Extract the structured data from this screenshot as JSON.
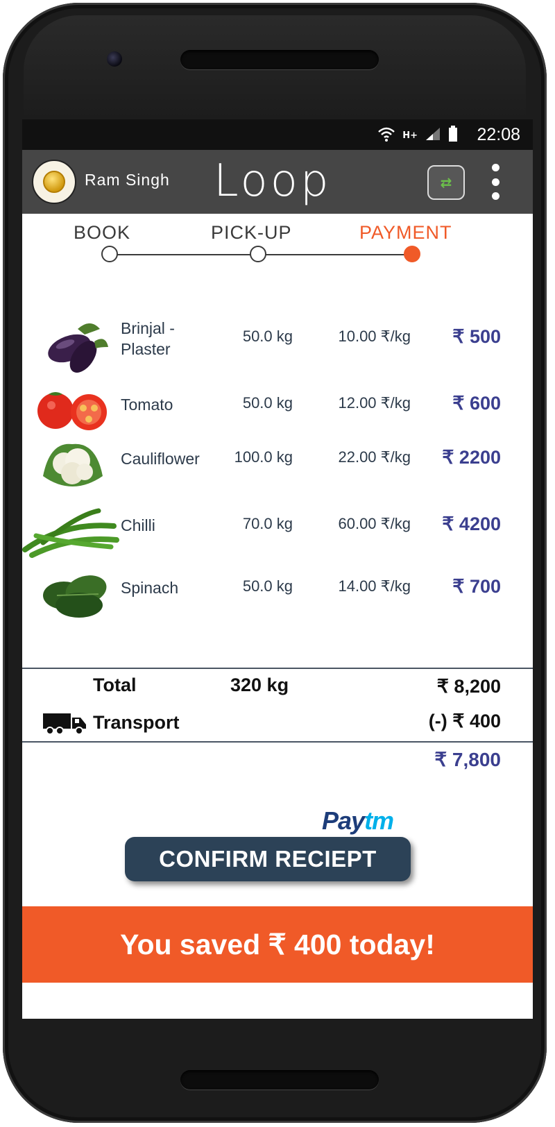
{
  "status_bar": {
    "network": "H+",
    "time": "22:08"
  },
  "app_bar": {
    "user_name": "Ram Singh",
    "logo": "Loop",
    "swap_icon": "swap-arrows-icon",
    "menu_icon": "overflow-menu-icon"
  },
  "stepper": {
    "steps": [
      {
        "label": "BOOK",
        "state": "done"
      },
      {
        "label": "PICK-UP",
        "state": "done"
      },
      {
        "label": "PAYMENT",
        "state": "active"
      }
    ],
    "active_color": "#f05a28"
  },
  "items": [
    {
      "name": "Brinjal - Plaster",
      "qty": "50.0  kg",
      "rate": "10.00 ₹/kg",
      "amount": "₹ 500",
      "icon": "brinjal-image"
    },
    {
      "name": "Tomato",
      "qty": "50.0  kg",
      "rate": "12.00 ₹/kg",
      "amount": "₹ 600",
      "icon": "tomato-image"
    },
    {
      "name": "Cauliflower",
      "qty": "100.0 kg",
      "rate": "22.00 ₹/kg",
      "amount": "₹ 2200",
      "icon": "cauliflower-image"
    },
    {
      "name": "Chilli",
      "qty": "70.0  kg",
      "rate": "60.00 ₹/kg",
      "amount": "₹ 4200",
      "icon": "chilli-image"
    },
    {
      "name": "Spinach",
      "qty": "50.0  kg",
      "rate": "14.00 ₹/kg",
      "amount": "₹ 700",
      "icon": "spinach-image"
    }
  ],
  "summary": {
    "total_label": "Total",
    "total_qty": "320 kg",
    "total_amount": "₹ 8,200",
    "transport_label": "Transport",
    "transport_amount": "(-) ₹ 400",
    "net_amount": "₹ 7,800"
  },
  "payment": {
    "provider_pay": "Pay",
    "provider_tm": "tm",
    "confirm_label": "CONFIRM RECIEPT"
  },
  "banner": {
    "text": "You saved ₹ 400 today!",
    "color": "#f05a28"
  },
  "colors": {
    "amount": "#3b3f8f",
    "button": "#2c4257",
    "appbar": "#464646"
  }
}
